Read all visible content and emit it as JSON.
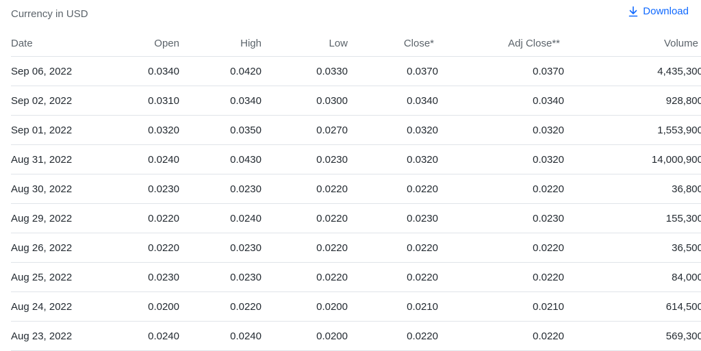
{
  "header": {
    "currency_note": "Currency in USD",
    "download_label": "Download",
    "download_icon": "download-arrow-icon",
    "accent_color": "#0f69ff"
  },
  "table": {
    "columns": [
      "Date",
      "Open",
      "High",
      "Low",
      "Close*",
      "Adj Close**",
      "Volume"
    ],
    "rows": [
      [
        "Sep 06, 2022",
        "0.0340",
        "0.0420",
        "0.0330",
        "0.0370",
        "0.0370",
        "4,435,300"
      ],
      [
        "Sep 02, 2022",
        "0.0310",
        "0.0340",
        "0.0300",
        "0.0340",
        "0.0340",
        "928,800"
      ],
      [
        "Sep 01, 2022",
        "0.0320",
        "0.0350",
        "0.0270",
        "0.0320",
        "0.0320",
        "1,553,900"
      ],
      [
        "Aug 31, 2022",
        "0.0240",
        "0.0430",
        "0.0230",
        "0.0320",
        "0.0320",
        "14,000,900"
      ],
      [
        "Aug 30, 2022",
        "0.0230",
        "0.0230",
        "0.0220",
        "0.0220",
        "0.0220",
        "36,800"
      ],
      [
        "Aug 29, 2022",
        "0.0220",
        "0.0240",
        "0.0220",
        "0.0230",
        "0.0230",
        "155,300"
      ],
      [
        "Aug 26, 2022",
        "0.0220",
        "0.0230",
        "0.0220",
        "0.0220",
        "0.0220",
        "36,500"
      ],
      [
        "Aug 25, 2022",
        "0.0230",
        "0.0230",
        "0.0220",
        "0.0220",
        "0.0220",
        "84,000"
      ],
      [
        "Aug 24, 2022",
        "0.0200",
        "0.0220",
        "0.0200",
        "0.0210",
        "0.0210",
        "614,500"
      ],
      [
        "Aug 23, 2022",
        "0.0240",
        "0.0240",
        "0.0200",
        "0.0220",
        "0.0220",
        "569,300"
      ]
    ]
  }
}
